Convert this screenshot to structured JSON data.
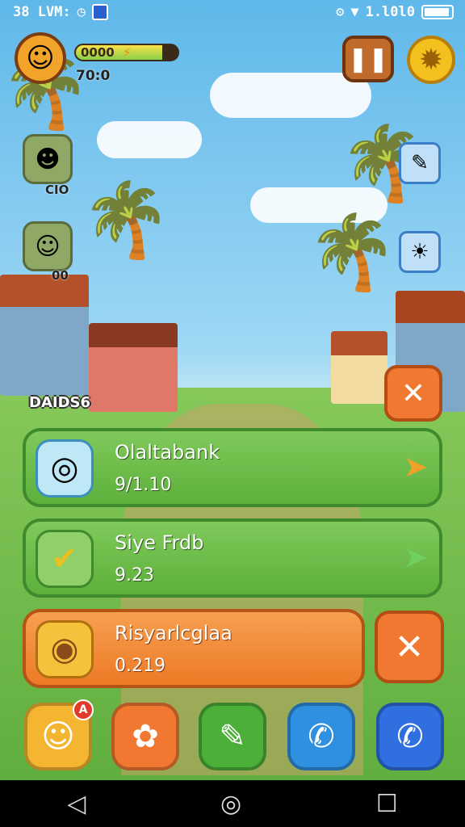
{
  "status_bar": {
    "left_text": "38 LVM:",
    "right_text": "1.l0l0",
    "icons": [
      "clock-icon",
      "app-icon",
      "signal-icon",
      "wifi-icon",
      "battery-icon"
    ]
  },
  "hud": {
    "energy_text": "0000",
    "energy_icon": "⚡",
    "energy_fraction": 0.85,
    "timer": "70:0",
    "pause_symbol": "❚❚",
    "gear_symbol": "✹"
  },
  "left_panel": {
    "friend1_label": "CIO",
    "friend2_label": "00"
  },
  "section_title": "DAIDS6",
  "items": [
    {
      "name": "Olaltabank",
      "value": "9/1.10",
      "icon": "◎",
      "action": "➤"
    },
    {
      "name": "Siye Frdb",
      "value": "9.23",
      "icon": "✔",
      "action": "➤"
    },
    {
      "name": "Risyarlcglaa",
      "value": "0.219",
      "icon": "◉"
    }
  ],
  "close_symbol": "✕",
  "bottom_bar": [
    {
      "name": "profile",
      "icon": "☺",
      "badge": "A"
    },
    {
      "name": "settings",
      "icon": "✿"
    },
    {
      "name": "build",
      "icon": "✎"
    },
    {
      "name": "chat",
      "icon": "✆"
    },
    {
      "name": "call",
      "icon": "✆"
    }
  ],
  "nav": {
    "back": "◁",
    "home": "◎",
    "recent": "☐"
  },
  "colors": {
    "green_card": "#5eb03c",
    "orange_card": "#ec7a26",
    "accent_blue": "#2f7fe0"
  }
}
